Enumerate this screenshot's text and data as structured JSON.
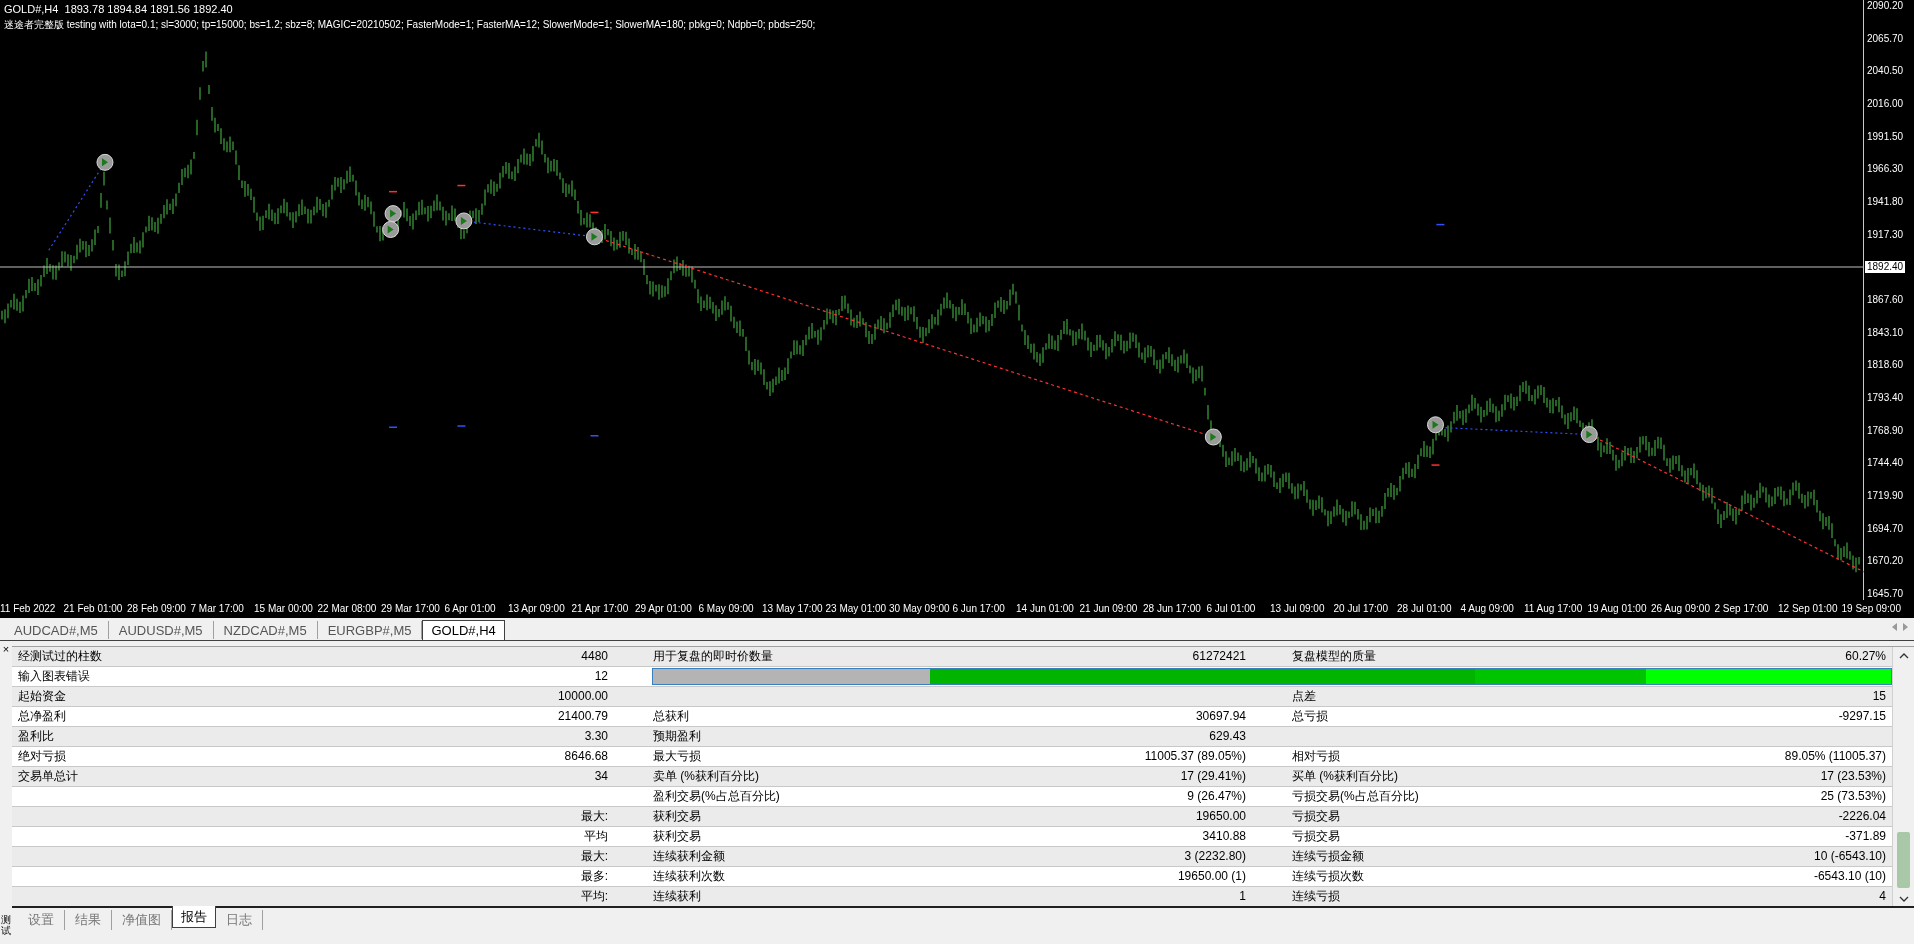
{
  "chart": {
    "symbol_line": "GOLD#,H4  1893.78 1894.84 1891.56 1892.40",
    "tester_line": "迷途者完整版 testing with lota=0.1; sl=3000; tp=15000; bs=1.2; sbz=8; MAGIC=20210502; FasterMode=1; FasterMA=12; SlowerMode=1; SlowerMA=180; pbkg=0; Ndpb=0; pbds=250;",
    "price_axis": [
      {
        "label": "2090.20",
        "current": false
      },
      {
        "label": "2065.70",
        "current": false
      },
      {
        "label": "2040.50",
        "current": false
      },
      {
        "label": "2016.00",
        "current": false
      },
      {
        "label": "1991.50",
        "current": false
      },
      {
        "label": "1966.30",
        "current": false
      },
      {
        "label": "1941.80",
        "current": false
      },
      {
        "label": "1917.30",
        "current": false
      },
      {
        "label": "1892.40",
        "current": true
      },
      {
        "label": "1867.60",
        "current": false
      },
      {
        "label": "1843.10",
        "current": false
      },
      {
        "label": "1818.60",
        "current": false
      },
      {
        "label": "1793.40",
        "current": false
      },
      {
        "label": "1768.90",
        "current": false
      },
      {
        "label": "1744.40",
        "current": false
      },
      {
        "label": "1719.90",
        "current": false
      },
      {
        "label": "1694.70",
        "current": false
      },
      {
        "label": "1670.20",
        "current": false
      },
      {
        "label": "1645.70",
        "current": false
      }
    ],
    "time_axis": [
      "11 Feb 2022",
      "21 Feb 01:00",
      "28 Feb 09:00",
      "7 Mar 17:00",
      "15 Mar 00:00",
      "22 Mar 08:00",
      "29 Mar 17:00",
      "6 Apr 01:00",
      "13 Apr 09:00",
      "21 Apr 17:00",
      "29 Apr 01:00",
      "6 May 09:00",
      "13 May 17:00",
      "23 May 01:00",
      "30 May 09:00",
      "6 Jun 17:00",
      "14 Jun 01:00",
      "21 Jun 09:00",
      "28 Jun 17:00",
      "6 Jul 01:00",
      "13 Jul 09:00",
      "20 Jul 17:00",
      "28 Jul 01:00",
      "4 Aug 09:00",
      "11 Aug 17:00",
      "19 Aug 01:00",
      "26 Aug 09:00",
      "2 Sep 17:00",
      "12 Sep 01:00",
      "19 Sep 09:00"
    ]
  },
  "symbol_tabs": [
    {
      "label": "AUDCAD#,M5",
      "selected": false
    },
    {
      "label": "AUDUSD#,M5",
      "selected": false
    },
    {
      "label": "NZDCAD#,M5",
      "selected": false
    },
    {
      "label": "EURGBP#,M5",
      "selected": false
    },
    {
      "label": "GOLD#,H4",
      "selected": true
    }
  ],
  "report": {
    "rows": [
      {
        "kind": "stats",
        "cells": [
          {
            "label": "经测试过的柱数",
            "value": "4480"
          },
          {
            "label": "用于复盘的即时价数量",
            "value": "61272421"
          },
          {
            "label": "复盘模型的质量",
            "value": "60.27%"
          }
        ]
      },
      {
        "kind": "quality_bar",
        "cells": [
          {
            "label": "输入图表错误",
            "value": "12"
          }
        ]
      },
      {
        "kind": "stats",
        "cells": [
          {
            "label": "起始资金",
            "value": "10000.00"
          },
          {},
          {
            "label": "点差",
            "value": "15"
          }
        ]
      },
      {
        "kind": "stats",
        "cells": [
          {
            "label": "总净盈利",
            "value": "21400.79"
          },
          {
            "label": "总获利",
            "value": "30697.94"
          },
          {
            "label": "总亏损",
            "value": "-9297.15"
          }
        ]
      },
      {
        "kind": "stats",
        "cells": [
          {
            "label": "盈利比",
            "value": "3.30"
          },
          {
            "label": "预期盈利",
            "value": "629.43"
          },
          {}
        ]
      },
      {
        "kind": "stats",
        "cells": [
          {
            "label": "绝对亏损",
            "value": "8646.68"
          },
          {
            "label": "最大亏损",
            "value": "11005.37 (89.05%)"
          },
          {
            "label": "相对亏损",
            "value": "89.05% (11005.37)"
          }
        ]
      },
      {
        "kind": "stats",
        "cells": [
          {
            "label": "交易单总计",
            "value": "34"
          },
          {
            "label": "卖单 (%获利百分比)",
            "value": "17 (29.41%)"
          },
          {
            "label": "买单 (%获利百分比)",
            "value": "17 (23.53%)"
          }
        ]
      },
      {
        "kind": "stats",
        "cells": [
          {},
          {
            "label": "盈利交易(%占总百分比)",
            "value": "9 (26.47%)"
          },
          {
            "label": "亏损交易(%占总百分比)",
            "value": "25 (73.53%)"
          }
        ]
      },
      {
        "kind": "stats",
        "cells": [
          {
            "value": "最大:"
          },
          {
            "label": "获利交易",
            "value": "19650.00"
          },
          {
            "label": "亏损交易",
            "value": "-2226.04"
          }
        ]
      },
      {
        "kind": "stats",
        "cells": [
          {
            "value": "平均"
          },
          {
            "label": "获利交易",
            "value": "3410.88"
          },
          {
            "label": "亏损交易",
            "value": "-371.89"
          }
        ]
      },
      {
        "kind": "stats",
        "cells": [
          {
            "value": "最大:"
          },
          {
            "label": "连续获利金额",
            "value": "3 (2232.80)"
          },
          {
            "label": "连续亏损金额",
            "value": "10 (-6543.10)"
          }
        ]
      },
      {
        "kind": "stats",
        "cells": [
          {
            "value": "最多:"
          },
          {
            "label": "连续获利次数",
            "value": "19650.00 (1)"
          },
          {
            "label": "连续亏损次数",
            "value": "-6543.10 (10)"
          }
        ]
      },
      {
        "kind": "stats",
        "cells": [
          {
            "value": "平均:"
          },
          {
            "label": "连续获利",
            "value": "1"
          },
          {
            "label": "连续亏损",
            "value": "4"
          }
        ]
      }
    ]
  },
  "bottom_tabs": [
    {
      "label": "设置",
      "selected": false
    },
    {
      "label": "结果",
      "selected": false
    },
    {
      "label": "净值图",
      "selected": false
    },
    {
      "label": "报告",
      "selected": true
    },
    {
      "label": "日志",
      "selected": false
    }
  ],
  "close_glyph": "×",
  "side_title": "测试"
}
